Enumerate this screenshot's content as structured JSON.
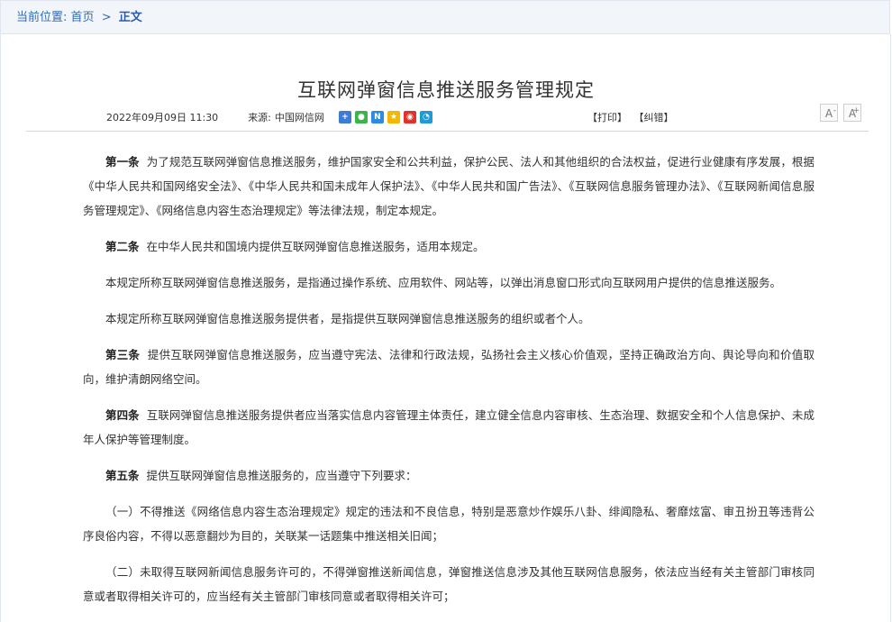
{
  "breadcrumb": {
    "label": "当前位置:",
    "home": "首页",
    "separator": ">",
    "current": "正文"
  },
  "article": {
    "title": "互联网弹窗信息推送服务管理规定",
    "date": "2022年09月09日 11:30",
    "source_label": "来源:",
    "source": "中国网信网",
    "print": "【打印】",
    "correct": "【纠错】",
    "font_smaller": "A",
    "font_larger": "A",
    "font_smaller_sign": "-",
    "font_larger_sign": "+",
    "share_icons": [
      "share-plus-icon",
      "wechat-icon",
      "news-icon",
      "qzone-icon",
      "weibo-icon",
      "tencent-weibo-icon"
    ],
    "paragraphs": [
      {
        "lead": "第一条",
        "text": "为了规范互联网弹窗信息推送服务，维护国家安全和公共利益，保护公民、法人和其他组织的合法权益，促进行业健康有序发展，根据《中华人民共和国网络安全法》、《中华人民共和国未成年人保护法》、《中华人民共和国广告法》、《互联网信息服务管理办法》、《互联网新闻信息服务管理规定》、《网络信息内容生态治理规定》等法律法规，制定本规定。"
      },
      {
        "lead": "第二条",
        "text": "在中华人民共和国境内提供互联网弹窗信息推送服务，适用本规定。"
      },
      {
        "lead": "",
        "text": "本规定所称互联网弹窗信息推送服务，是指通过操作系统、应用软件、网站等，以弹出消息窗口形式向互联网用户提供的信息推送服务。"
      },
      {
        "lead": "",
        "text": "本规定所称互联网弹窗信息推送服务提供者，是指提供互联网弹窗信息推送服务的组织或者个人。"
      },
      {
        "lead": "第三条",
        "text": "提供互联网弹窗信息推送服务，应当遵守宪法、法律和行政法规，弘扬社会主义核心价值观，坚持正确政治方向、舆论导向和价值取向，维护清朗网络空间。"
      },
      {
        "lead": "第四条",
        "text": "互联网弹窗信息推送服务提供者应当落实信息内容管理主体责任，建立健全信息内容审核、生态治理、数据安全和个人信息保护、未成年人保护等管理制度。"
      },
      {
        "lead": "第五条",
        "text": "提供互联网弹窗信息推送服务的，应当遵守下列要求："
      },
      {
        "lead": "",
        "text": "（一）不得推送《网络信息内容生态治理规定》规定的违法和不良信息，特别是恶意炒作娱乐八卦、绯闻隐私、奢靡炫富、审丑扮丑等违背公序良俗内容，不得以恶意翻炒为目的，关联某一话题集中推送相关旧闻；"
      },
      {
        "lead": "",
        "text": "（二）未取得互联网新闻信息服务许可的，不得弹窗推送新闻信息，弹窗推送信息涉及其他互联网信息服务，依法应当经有关主管部门审核同意或者取得相关许可的，应当经有关主管部门审核同意或者取得相关许可；"
      }
    ]
  }
}
